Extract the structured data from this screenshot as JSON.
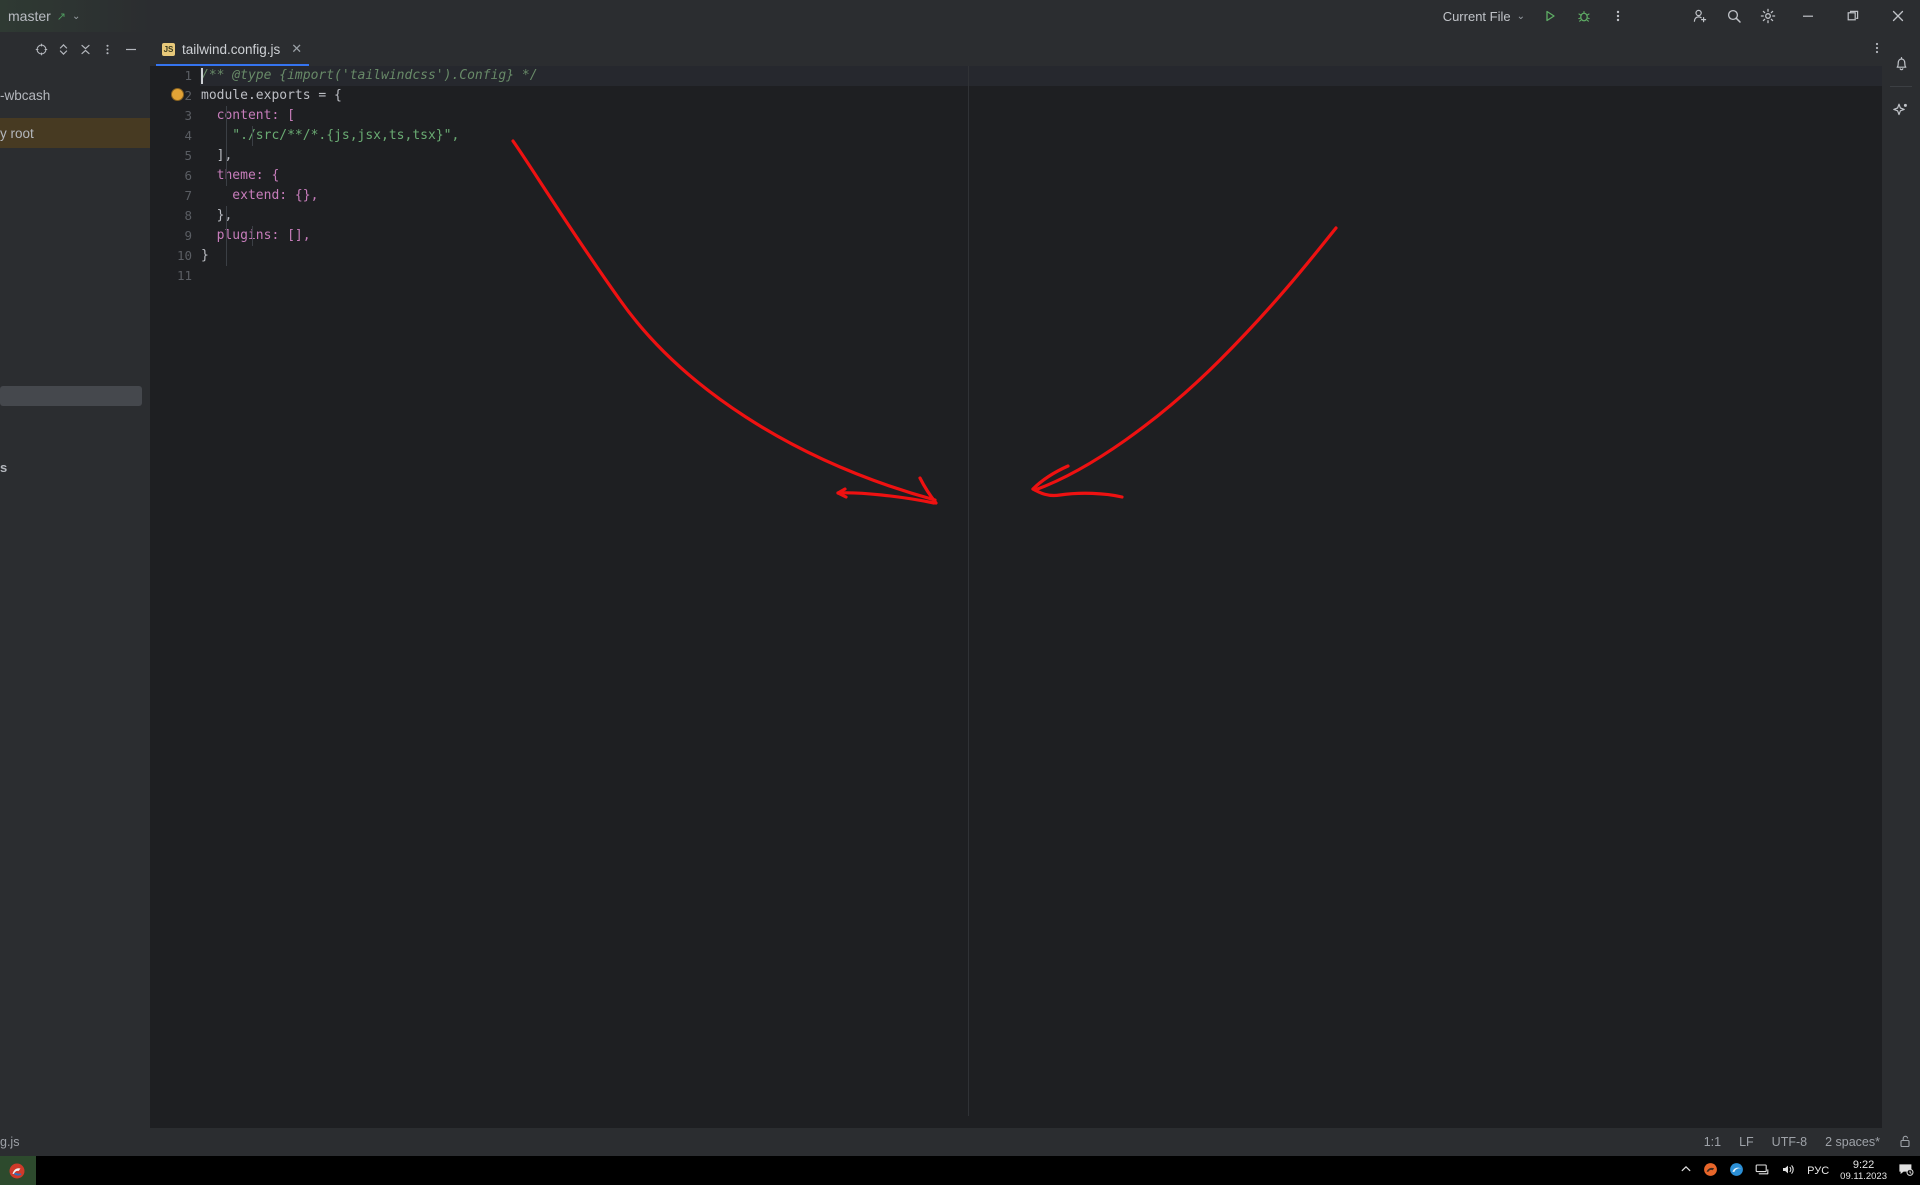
{
  "titlebar": {
    "branch": "master",
    "branch_arrow_icon": "arrow-up-right-icon",
    "branch_chevron_icon": "chevron-down-icon",
    "run_config": "Current File",
    "run_config_chevron_icon": "chevron-down-icon",
    "run_icon": "run-play-icon",
    "debug_icon": "debug-bug-icon",
    "more_icon": "more-vertical-icon",
    "account_icon": "add-user-icon",
    "search_icon": "search-icon",
    "settings_icon": "gear-icon",
    "minimize_icon": "window-minimize-icon",
    "maximize_icon": "window-restore-icon",
    "close_icon": "window-close-icon"
  },
  "project_pane": {
    "items": [
      {
        "label": "-wbcash",
        "selected": false
      },
      {
        "label": "y root",
        "selected": true
      },
      {
        "label": "s",
        "selected": false
      }
    ]
  },
  "editor_toolbar": {
    "locate_icon": "crosshair-target-icon",
    "expand_collapse_icon": "expand-collapse-icon",
    "collapse_all_icon": "collapse-all-icon",
    "options_icon": "more-vertical-icon",
    "hide_icon": "minimize-panel-icon"
  },
  "tabs": [
    {
      "label": "tailwind.config.js",
      "file_type": "JS",
      "active": true,
      "close_icon": "close-icon"
    }
  ],
  "tabbar": {
    "more_icon": "more-vertical-icon"
  },
  "editor": {
    "inspection_status_icon": "checkmark-ok-icon",
    "line_numbers": [
      "1",
      "2",
      "3",
      "4",
      "5",
      "6",
      "7",
      "8",
      "9",
      "10",
      "11"
    ],
    "lines": [
      {
        "n": 1,
        "text": "/** @type {import('tailwindcss').Config} */"
      },
      {
        "n": 2,
        "text": "module.exports = {"
      },
      {
        "n": 3,
        "text": "  content: ["
      },
      {
        "n": 4,
        "text": "    \"./src/**/*.{js,jsx,ts,tsx}\","
      },
      {
        "n": 5,
        "text": "  ],"
      },
      {
        "n": 6,
        "text": "  theme: {"
      },
      {
        "n": 7,
        "text": "    extend: {},"
      },
      {
        "n": 8,
        "text": "  },"
      },
      {
        "n": 9,
        "text": "  plugins: [],"
      },
      {
        "n": 10,
        "text": "}"
      },
      {
        "n": 11,
        "text": ""
      }
    ],
    "gutter_hint_icon": "intention-bulb-icon"
  },
  "right_rail": {
    "notifications_icon": "bell-icon",
    "ai_assistant_icon": "sparkle-ai-icon"
  },
  "statusbar": {
    "breadcrumb": "g.js",
    "caret_position": "1:1",
    "line_separator": "LF",
    "encoding": "UTF-8",
    "indent": "2 spaces*",
    "lock_icon": "unlocked-padlock-icon"
  },
  "taskbar": {
    "start_icon": "windows-start-icon",
    "chevron_icon": "tray-chevron-up-icon",
    "tray_icons": [
      "antivirus-shield-icon",
      "browser-icon",
      "network-icon",
      "volume-icon"
    ],
    "language": "РУС",
    "time": "9:22",
    "date": "09.11.2023",
    "notifications_icon": "action-center-icon"
  },
  "annotations": {
    "color": "#ee1111",
    "arrows": [
      {
        "name": "arrow-left-downward",
        "description": "red hand-drawn arrow pointing down-right"
      },
      {
        "name": "arrow-right-downward",
        "description": "red hand-drawn arrow pointing down-left"
      }
    ]
  },
  "colors": {
    "accent": "#3574f0",
    "editor_bg": "#1e1f22",
    "chrome_bg": "#2b2d30",
    "selection": "#473a22",
    "annotation_red": "#ee1111",
    "run_green": "#5fad65",
    "string_green": "#6aab73",
    "keyword_orange": "#cf8e6d",
    "property_pink": "#c77dbb"
  }
}
